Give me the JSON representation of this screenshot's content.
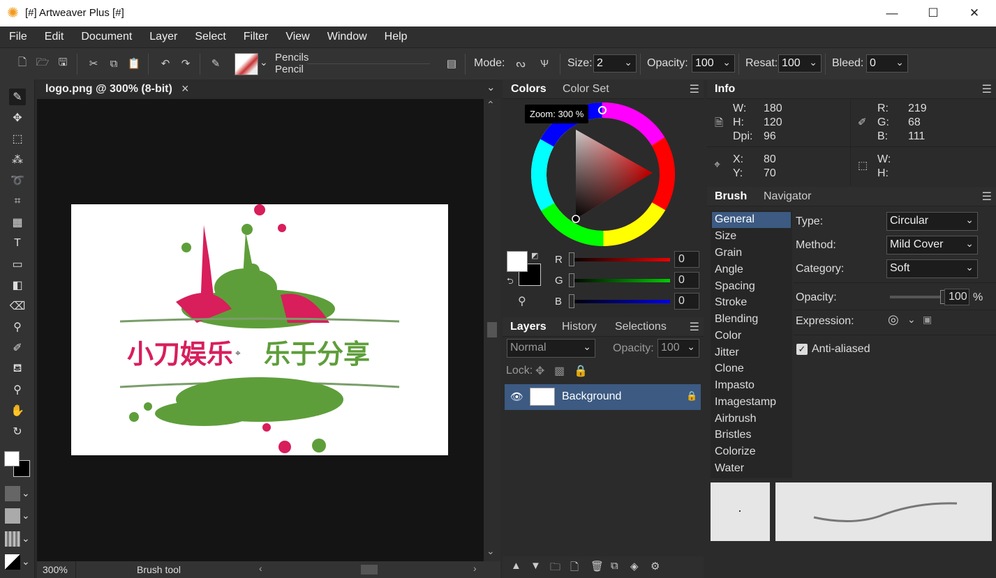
{
  "window": {
    "title": "[#] Artweaver Plus [#]"
  },
  "menu": [
    "File",
    "Edit",
    "Document",
    "Layer",
    "Select",
    "Filter",
    "View",
    "Window",
    "Help"
  ],
  "toolbar": {
    "brush_category": "Pencils",
    "brush_name": "Pencil",
    "mode_label": "Mode:",
    "size_label": "Size:",
    "size_value": "2",
    "opacity_label": "Opacity:",
    "opacity_value": "100",
    "resat_label": "Resat:",
    "resat_value": "100",
    "bleed_label": "Bleed:",
    "bleed_value": "0"
  },
  "document": {
    "tab_title": "logo.png @ 300% (8-bit)",
    "close_glyph": "×",
    "logo_text_red": "小刀娱乐",
    "logo_text_green": "乐于分享",
    "zoom_status": "300%",
    "tool_status": "Brush tool"
  },
  "colors": {
    "tabs": [
      "Colors",
      "Color Set"
    ],
    "zoom_tooltip": "Zoom: 300 %",
    "r_label": "R",
    "r_value": "0",
    "g_label": "G",
    "g_value": "0",
    "b_label": "B",
    "b_value": "0"
  },
  "info": {
    "title": "Info",
    "w_label": "W:",
    "w_value": "180",
    "h_label": "H:",
    "h_value": "120",
    "dpi_label": "Dpi:",
    "dpi_value": "96",
    "r_label": "R:",
    "r_value": "219",
    "g_label": "G:",
    "g_value": "68",
    "b_label": "B:",
    "b_value": "111",
    "x_label": "X:",
    "x_value": "80",
    "y_label": "Y:",
    "y_value": "70",
    "sw_label": "W:",
    "sh_label": "H:"
  },
  "layers": {
    "tabs": [
      "Layers",
      "History",
      "Selections"
    ],
    "blend_mode": "Normal",
    "opacity_label": "Opacity:",
    "opacity_value": "100",
    "lock_label": "Lock:",
    "layer_name": "Background"
  },
  "brush": {
    "tabs": [
      "Brush",
      "Navigator"
    ],
    "categories": [
      "General",
      "Size",
      "Grain",
      "Angle",
      "Spacing",
      "Stroke",
      "Blending",
      "Color",
      "Jitter",
      "Clone",
      "Impasto",
      "Imagestamp",
      "Airbrush",
      "Bristles",
      "Colorize",
      "Water"
    ],
    "type_label": "Type:",
    "type_value": "Circular",
    "method_label": "Method:",
    "method_value": "Mild Cover",
    "category_label": "Category:",
    "category_value": "Soft",
    "opacity_label": "Opacity:",
    "opacity_value": "100",
    "opacity_unit": "%",
    "expression_label": "Expression:",
    "antialias_label": "Anti-aliased",
    "antialias_checked": true
  },
  "colors_palette": {
    "accent": "#3c5a82",
    "logo_red": "#d81e5b",
    "logo_green": "#5e9e3a",
    "bg": "#2b2b2b"
  }
}
